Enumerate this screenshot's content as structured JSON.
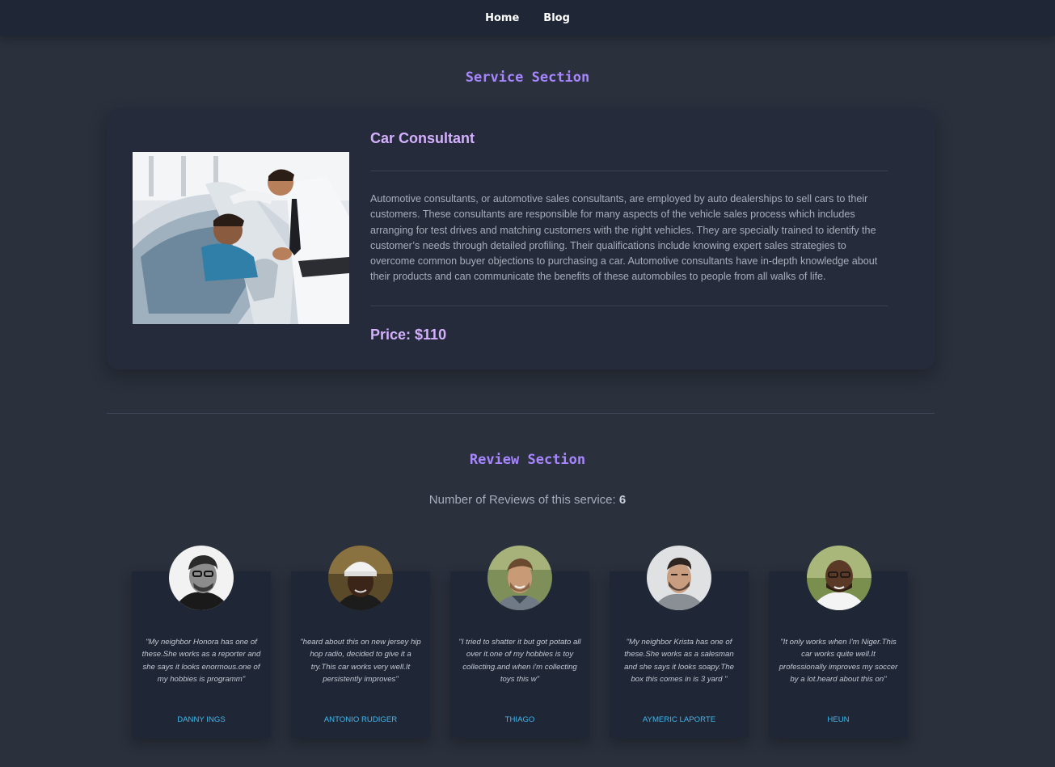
{
  "nav": {
    "items": [
      {
        "label": "Home"
      },
      {
        "label": "Blog"
      }
    ]
  },
  "service_section": {
    "title": "Service Section",
    "service": {
      "name": "Car Consultant",
      "description": "Automotive consultants, or automotive sales consultants, are employed by auto dealerships to sell cars to their customers. These consultants are responsible for many aspects of the vehicle sales process which includes arranging for test drives and matching customers with the right vehicles. They are specially trained to identify the customer’s needs through detailed profiling. Their qualifications include knowing expert sales strategies to overcome common buyer objections to purchasing a car. Automotive consultants have in-depth knowledge about their products and can communicate the benefits of these automobiles to people from all walks of life.",
      "price": "Price: $110"
    }
  },
  "review_section": {
    "title": "Review Section",
    "count_label": "Number of Reviews of this service: ",
    "count": "6",
    "reviews": [
      {
        "text": "\"My neighbor Honora has one of these.She works as a reporter and she says it looks enormous.one of my hobbies is programm\"",
        "name": "Danny Ings"
      },
      {
        "text": "\"heard about this on new jersey hip hop radio, decided to give it a try.This car works very well.It persistently improves\"",
        "name": "Antonio Rudiger"
      },
      {
        "text": "\"I tried to shatter it but got potato all over it.one of my hobbies is toy collecting.and when i'm collecting toys this w\"",
        "name": "Thiago"
      },
      {
        "text": "\"My neighbor Krista has one of these.She works as a salesman and she says it looks soapy.The box this comes in is 3 yard \"",
        "name": "Aymeric Laporte"
      },
      {
        "text": "\"It only works when I'm Niger.This car works quite well.It professionally improves my soccer by a lot.heard about this on\"",
        "name": "Heun"
      }
    ]
  },
  "colors": {
    "background": "#2a303c",
    "navbar": "#1f2737",
    "card": "#252b3a",
    "accent_purple": "#a786ff",
    "heading_lavender": "#d4b0ff",
    "reviewer_name": "#3fb8f0"
  }
}
